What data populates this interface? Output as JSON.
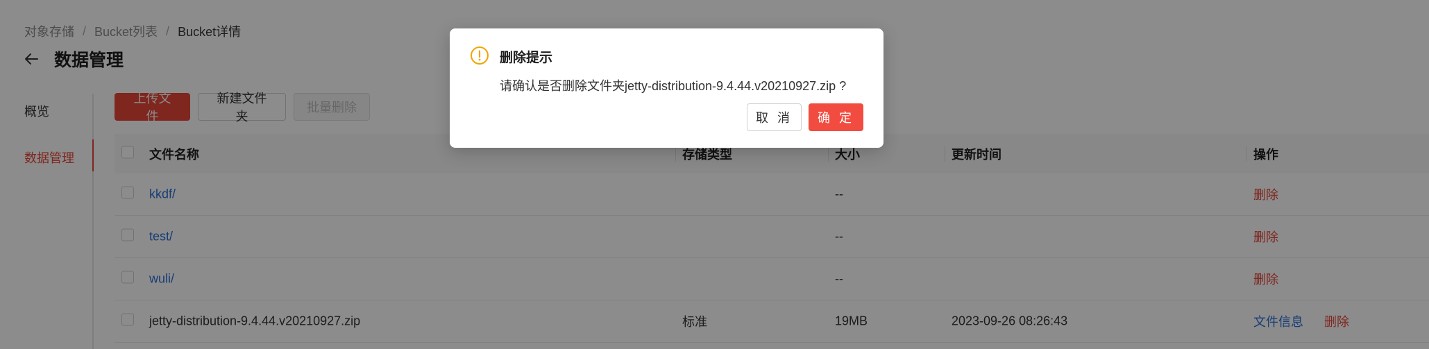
{
  "breadcrumb": [
    "对象存储",
    "Bucket列表",
    "Bucket详情"
  ],
  "breadcrumb_separator": "/",
  "page_title": "数据管理",
  "side_nav": {
    "items": [
      {
        "label": "概览",
        "active": false
      },
      {
        "label": "数据管理",
        "active": true
      }
    ]
  },
  "toolbar": {
    "upload_label": "上传文件",
    "new_folder_label": "新建文件夹",
    "batch_delete_label": "批量删除"
  },
  "table": {
    "columns": {
      "name": "文件名称",
      "type": "存储类型",
      "size": "大小",
      "time": "更新时间",
      "ops": "操作"
    },
    "rows": [
      {
        "name": "kkdf/",
        "type": "",
        "size": "--",
        "time": "",
        "ops": [
          "删除"
        ]
      },
      {
        "name": "test/",
        "type": "",
        "size": "--",
        "time": "",
        "ops": [
          "删除"
        ]
      },
      {
        "name": "wuli/",
        "type": "",
        "size": "--",
        "time": "",
        "ops": [
          "删除"
        ]
      },
      {
        "name": "jetty-distribution-9.4.44.v20210927.zip",
        "type": "标准",
        "size": "19MB",
        "time": "2023-09-26 08:26:43",
        "ops": [
          "文件信息",
          "删除"
        ]
      }
    ]
  },
  "modal": {
    "title": "删除提示",
    "content": "请确认是否删除文件夹jetty-distribution-9.4.44.v20210927.zip ?",
    "cancel_label": "取 消",
    "ok_label": "确 定",
    "icon": "exclamation-circle-icon"
  },
  "colors": {
    "primary": "#e8463a",
    "link": "#2b6fd6",
    "warning": "#f0a500"
  }
}
